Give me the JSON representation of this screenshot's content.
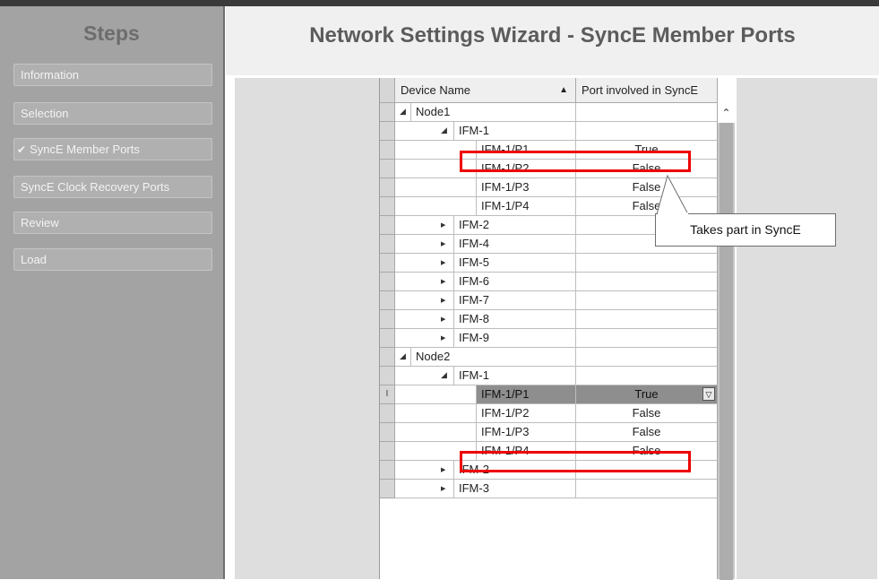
{
  "steps": {
    "title": "Steps",
    "items": [
      {
        "label": "Information",
        "checked": false
      },
      {
        "label": "Selection",
        "checked": false
      },
      {
        "label": "SyncE Member Ports",
        "checked": true
      },
      {
        "label": "SyncE Clock Recovery Ports",
        "checked": false
      },
      {
        "label": "Review",
        "checked": false
      },
      {
        "label": "Load",
        "checked": false
      }
    ]
  },
  "header": {
    "title": "Network Settings Wizard - SyncE Member Ports"
  },
  "grid": {
    "columns": [
      {
        "label": "Device Name",
        "sort": "ascending"
      },
      {
        "label": "Port involved in SyncE"
      }
    ],
    "rows": [
      {
        "name": "Node1",
        "level": 0,
        "expander": "expanded",
        "value": ""
      },
      {
        "name": "IFM-1",
        "level": 1,
        "expander": "expanded",
        "value": ""
      },
      {
        "name": "IFM-1/P1",
        "level": 2,
        "expander": "none",
        "value": "True"
      },
      {
        "name": "IFM-1/P2",
        "level": 2,
        "expander": "none",
        "value": "False"
      },
      {
        "name": "IFM-1/P3",
        "level": 2,
        "expander": "none",
        "value": "False"
      },
      {
        "name": "IFM-1/P4",
        "level": 2,
        "expander": "none",
        "value": "False"
      },
      {
        "name": "IFM-2",
        "level": 1,
        "expander": "collapsed",
        "value": ""
      },
      {
        "name": "IFM-4",
        "level": 1,
        "expander": "collapsed",
        "value": ""
      },
      {
        "name": "IFM-5",
        "level": 1,
        "expander": "collapsed",
        "value": ""
      },
      {
        "name": "IFM-6",
        "level": 1,
        "expander": "collapsed",
        "value": ""
      },
      {
        "name": "IFM-7",
        "level": 1,
        "expander": "collapsed",
        "value": ""
      },
      {
        "name": "IFM-8",
        "level": 1,
        "expander": "collapsed",
        "value": ""
      },
      {
        "name": "IFM-9",
        "level": 1,
        "expander": "collapsed",
        "value": ""
      },
      {
        "name": "Node2",
        "level": 0,
        "expander": "expanded",
        "value": ""
      },
      {
        "name": "IFM-1",
        "level": 1,
        "expander": "expanded",
        "value": ""
      },
      {
        "name": "IFM-1/P1",
        "level": 2,
        "expander": "none",
        "value": "True",
        "selected": true,
        "editing": true
      },
      {
        "name": "IFM-1/P2",
        "level": 2,
        "expander": "none",
        "value": "False"
      },
      {
        "name": "IFM-1/P3",
        "level": 2,
        "expander": "none",
        "value": "False"
      },
      {
        "name": "IFM-1/P4",
        "level": 2,
        "expander": "none",
        "value": "False"
      },
      {
        "name": "IFM-2",
        "level": 1,
        "expander": "collapsed",
        "value": ""
      },
      {
        "name": "IFM-3",
        "level": 1,
        "expander": "collapsed",
        "value": ""
      }
    ],
    "edit_cursor_glyph": "I"
  },
  "annotation": {
    "callout_text": "Takes part in SyncE",
    "highlight_color": "#ee0000"
  },
  "icons": {
    "sort": "sort-ascending-icon",
    "expanded": "expanded-triangle-icon",
    "collapsed": "collapsed-triangle-icon",
    "check": "check-icon",
    "dropdown": "chevron-down-icon",
    "scroll_up": "scroll-up-icon"
  }
}
